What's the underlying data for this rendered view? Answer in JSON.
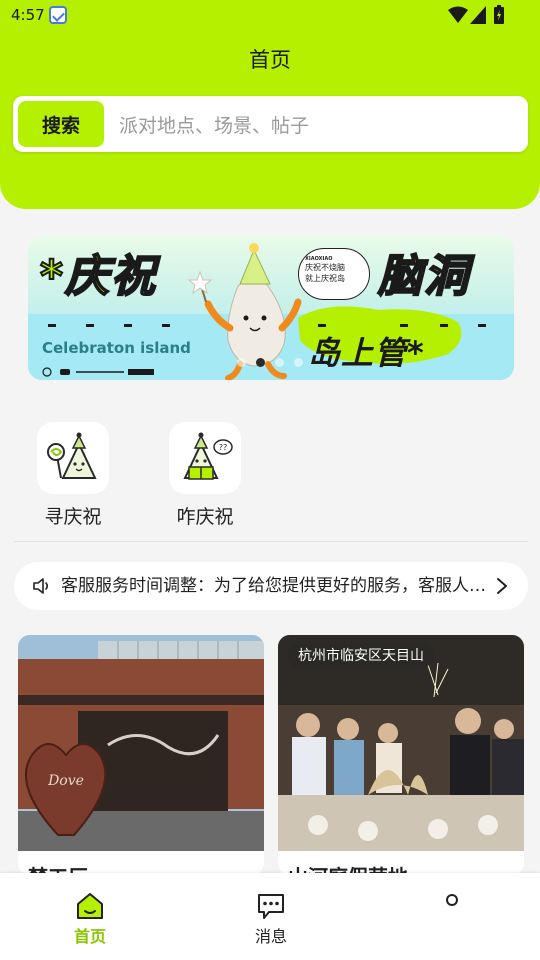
{
  "status_bar": {
    "time": "4:57"
  },
  "header": {
    "title": "首页"
  },
  "search": {
    "button_label": "搜索",
    "placeholder": "派对地点、场景、帖子"
  },
  "banner": {
    "left_text": "*庆祝",
    "right_text": "脑洞",
    "bubble_brand": "XIAOXIAO",
    "bubble_line1": "庆祝不烧脑",
    "bubble_line2": "就上庆祝岛",
    "caption": "Celebraton island",
    "sub_text": "岛上管*",
    "slide_count": 4,
    "active_slide": 1
  },
  "quick_entries": [
    {
      "label": "寻庆祝",
      "icon": "mascot-lollipop-icon"
    },
    {
      "label": "咋庆祝",
      "icon": "mascot-book-icon"
    }
  ],
  "notice": {
    "text": "客服服务时间调整：为了给您提供更好的服务，客服人员服务时间调整为"
  },
  "cards": [
    {
      "title": "梦工厂",
      "location": ""
    },
    {
      "title": "山河庭假营地",
      "location": "杭州市临安区天目山"
    }
  ],
  "bottom_nav": {
    "items": [
      {
        "label": "首页",
        "icon": "home-icon",
        "active": true
      },
      {
        "label": "消息",
        "icon": "message-icon",
        "active": false
      }
    ]
  },
  "colors": {
    "accent": "#b5f000",
    "active_nav": "#8ac400"
  }
}
